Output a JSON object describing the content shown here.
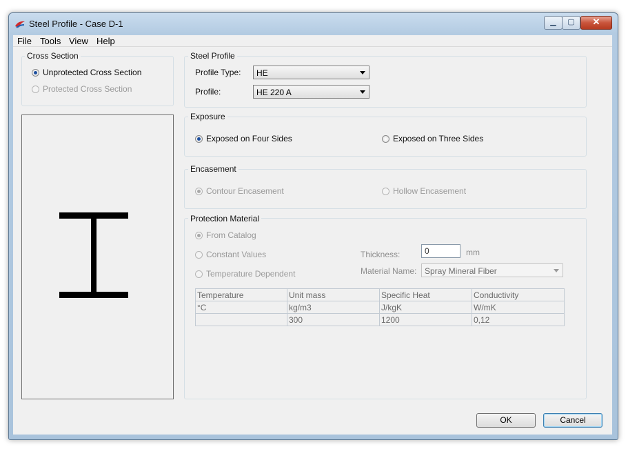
{
  "window": {
    "title": "Steel Profile - Case D-1"
  },
  "menu": [
    "File",
    "Tools",
    "View",
    "Help"
  ],
  "cross_section": {
    "title": "Cross Section",
    "options": [
      {
        "label": "Unprotected Cross Section",
        "selected": true,
        "enabled": true
      },
      {
        "label": "Protected Cross Section",
        "selected": false,
        "enabled": false
      }
    ]
  },
  "steel_profile": {
    "title": "Steel Profile",
    "type_label": "Profile Type:",
    "type_value": "HE",
    "profile_label": "Profile:",
    "profile_value": "HE 220 A"
  },
  "exposure": {
    "title": "Exposure",
    "four_sides": "Exposed on Four Sides",
    "three_sides": "Exposed on Three Sides"
  },
  "encasement": {
    "title": "Encasement",
    "contour": "Contour Encasement",
    "hollow": "Hollow Encasement"
  },
  "protection": {
    "title": "Protection Material",
    "from_catalog": "From Catalog",
    "constant_values": "Constant Values",
    "temperature_dependent": "Temperature Dependent",
    "thickness_label": "Thickness:",
    "thickness_value": "0",
    "thickness_unit": "mm",
    "material_label": "Material Name:",
    "material_value": "Spray Mineral Fiber",
    "table": {
      "headers": [
        "Temperature",
        "Unit mass",
        "Specific Heat",
        "Conductivity"
      ],
      "units": [
        "°C",
        "kg/m3",
        "J/kgK",
        "W/mK"
      ],
      "values": [
        "",
        "300",
        "1200",
        "0,12"
      ]
    }
  },
  "buttons": {
    "ok": "OK",
    "cancel": "Cancel"
  },
  "icons": {
    "app": "app-logo-icon",
    "minimize": "minimize-icon",
    "maximize": "maximize-icon",
    "close": "close-icon",
    "profile_shape": "i-beam-icon"
  }
}
